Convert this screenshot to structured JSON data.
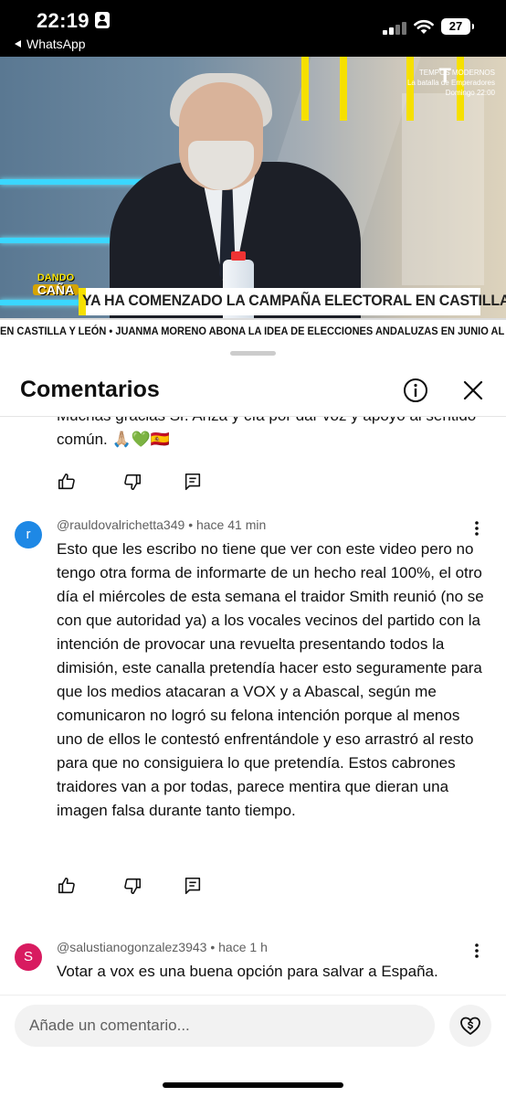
{
  "status_bar": {
    "time": "22:19",
    "back_app": "WhatsApp",
    "battery": "27"
  },
  "video": {
    "channel": "TEMPOS MODERNOS",
    "show_line": "La batalla de Emperadores",
    "schedule": "Domingo 22:00",
    "channel_logo": "T",
    "show_logo_top": "DANDO",
    "show_logo_bottom": "CAÑA",
    "headline": "YA HA COMENZADO LA CAMPAÑA ELECTORAL EN CASTILLA Y LEÓN",
    "ticker": "EN CASTILLA Y LEÓN  •  JUANMA MORENO ABONA LA IDEA DE ELECCIONES ANDALUZAS EN JUNIO AL CONFIRMA"
  },
  "sheet": {
    "title": "Comentarios",
    "info_icon": "info-icon",
    "close_icon": "close-icon"
  },
  "comments": [
    {
      "text": "Muchas gracias Sr. Ariza y cía por dar voz y apoyo al sentido común. 🙏🏼💚🇪🇸"
    },
    {
      "avatar_letter": "r",
      "avatar_color": "#1e88e5",
      "handle": "@rauldovalrichetta349",
      "time": "hace 41 min",
      "text": "Esto que les escribo no tiene que ver con este video pero no tengo otra forma de informarte de un hecho real 100%, el otro día el miércoles de esta semana el traidor Smith reunió (no se con que autoridad ya) a los vocales vecinos del partido con la intención de provocar una revuelta presentando todos la dimisión, este canalla pretendía hacer esto seguramente para que los medios atacaran a VOX y a Abascal, según me comunicaron no logró su felona intención porque al menos uno de ellos le contestó enfrentándole y eso arrastró al resto para que no consiguiera lo que pretendía. Estos cabrones traidores van a por todas, parece mentira que dieran una imagen falsa durante tanto tiempo."
    },
    {
      "avatar_letter": "S",
      "avatar_color": "#d81b60",
      "handle": "@salustianogonzalez3943",
      "time": "hace 1 h",
      "text": "Votar a vox es una buena opción para salvar a España."
    }
  ],
  "footer": {
    "placeholder": "Añade un comentario..."
  },
  "colors": {
    "meta": "#606060",
    "text": "#0f0f0f",
    "accent_yellow": "#f6e000"
  }
}
